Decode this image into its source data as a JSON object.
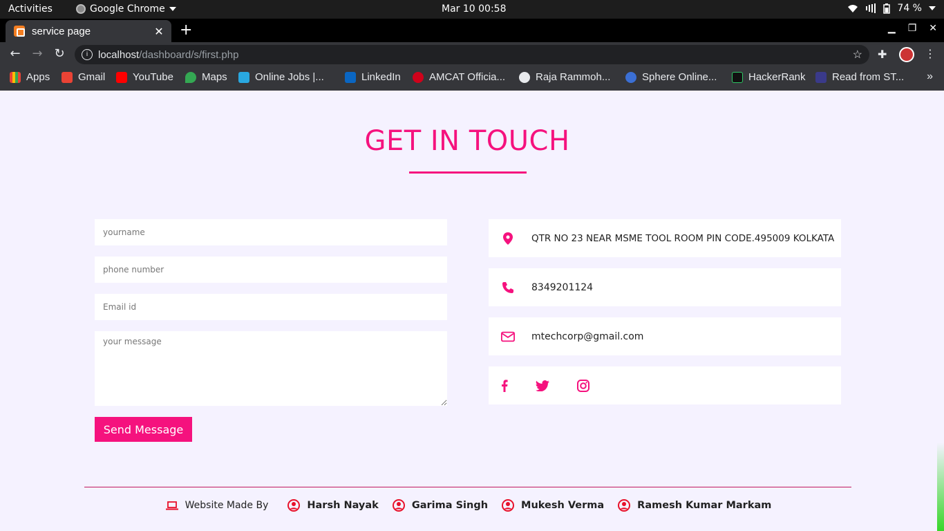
{
  "os": {
    "activities": "Activities",
    "app_name": "Google Chrome",
    "clock": "Mar 10  00:58",
    "battery": "74 %"
  },
  "browser": {
    "tab_title": "service page",
    "url_host": "localhost",
    "url_path": "/dashboard/s/first.php",
    "bookmarks": [
      {
        "label": "Apps",
        "icon": "apps-grid-icon",
        "color": "#4285f4"
      },
      {
        "label": "Gmail",
        "icon": "gmail-icon",
        "color": "#ea4335"
      },
      {
        "label": "YouTube",
        "icon": "youtube-icon",
        "color": "#ff0000"
      },
      {
        "label": "Maps",
        "icon": "maps-icon",
        "color": "#34a853"
      },
      {
        "label": "Online Jobs |...",
        "icon": "online-jobs-icon",
        "color": "#29a8e0"
      },
      {
        "label": "LinkedIn",
        "icon": "linkedin-icon",
        "color": "#0a66c2"
      },
      {
        "label": "AMCAT Officia...",
        "icon": "amcat-icon",
        "color": "#d0021b"
      },
      {
        "label": "Raja Rammoh...",
        "icon": "globe-icon",
        "color": "#e8eaed"
      },
      {
        "label": "Sphere Online...",
        "icon": "sphere-icon",
        "color": "#3b6fd4"
      },
      {
        "label": "HackerRank",
        "icon": "hackerrank-icon",
        "color": "#111111"
      },
      {
        "label": "Read from ST...",
        "icon": "read-icon",
        "color": "#3a3a8a"
      }
    ]
  },
  "page": {
    "heading": "GET IN TOUCH",
    "accent_color": "#f5127e",
    "form": {
      "name_placeholder": "yourname",
      "phone_placeholder": "phone number",
      "email_placeholder": "Email id",
      "message_placeholder": "your message",
      "submit_label": "Send Message"
    },
    "contact": {
      "address": "QTR NO 23 NEAR MSME TOOL ROOM PIN CODE.495009 KOLKATA",
      "phone": "8349201124",
      "email": "mtechcorp@gmail.com",
      "social": [
        "facebook-icon",
        "twitter-icon",
        "instagram-icon"
      ]
    },
    "footer": {
      "made_by": "Website Made By",
      "authors": [
        "Harsh Nayak",
        "Garima Singh",
        "Mukesh Verma",
        "Ramesh Kumar Markam"
      ]
    }
  }
}
